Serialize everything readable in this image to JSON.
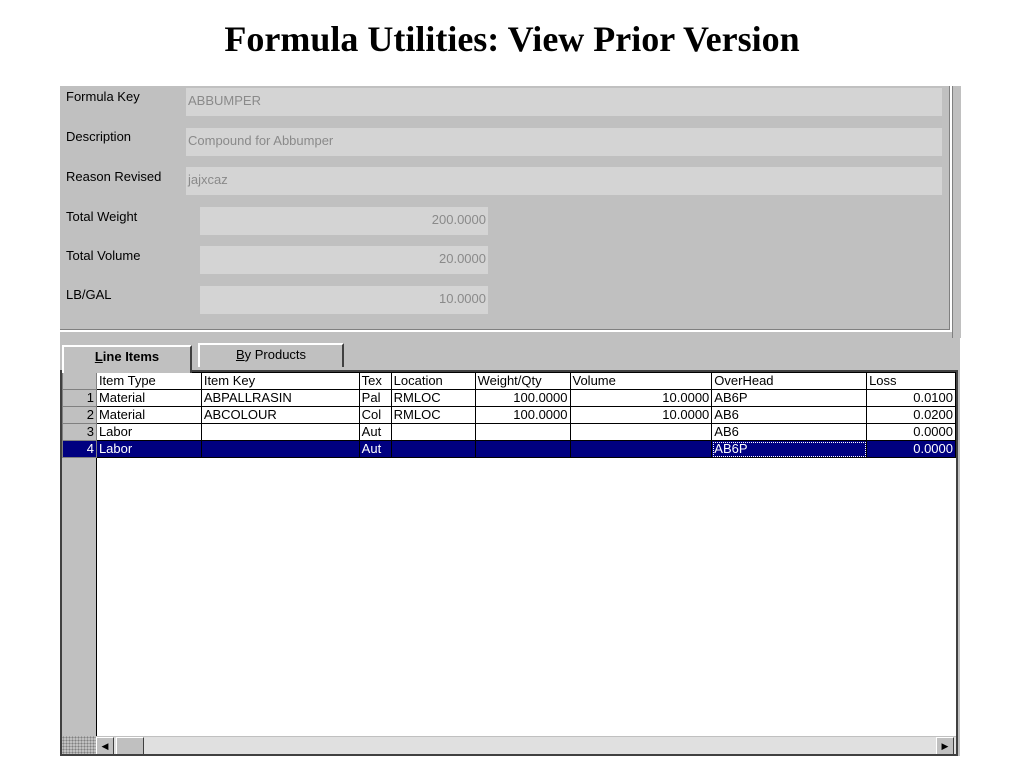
{
  "slide": {
    "title": "Formula Utilities: View Prior Version"
  },
  "form": {
    "formula_key_label": "Formula Key",
    "formula_key_value": "ABBUMPER",
    "description_label": "Description",
    "description_value": "Compound for Abbumper",
    "reason_label": "Reason Revised",
    "reason_value": "jajxcaz",
    "total_weight_label": "Total Weight",
    "total_weight_value": "200.0000",
    "total_volume_label": "Total Volume",
    "total_volume_value": "20.0000",
    "lbgal_label": "LB/GAL",
    "lbgal_value": "10.0000"
  },
  "tabs": {
    "line_items_first": "L",
    "line_items_rest": "ine Items",
    "by_products_first": "B",
    "by_products_rest": "y Products"
  },
  "grid": {
    "headers": [
      "Item Type",
      "Item Key",
      "Tex",
      "Location",
      "Weight/Qty",
      "Volume",
      "OverHead",
      "Loss"
    ],
    "rows": [
      {
        "n": "1",
        "type": "Material",
        "key": "ABPALLRASIN",
        "tex": "Pal",
        "loc": "RMLOC",
        "wq": "100.0000",
        "vol": "10.0000",
        "oh": "AB6P",
        "loss": "0.0100"
      },
      {
        "n": "2",
        "type": "Material",
        "key": "ABCOLOUR",
        "tex": "Col",
        "loc": "RMLOC",
        "wq": "100.0000",
        "vol": "10.0000",
        "oh": "AB6",
        "loss": "0.0200"
      },
      {
        "n": "3",
        "type": "Labor",
        "key": "",
        "tex": "Aut",
        "loc": "",
        "wq": "",
        "vol": "",
        "oh": "AB6",
        "loss": "0.0000"
      },
      {
        "n": "4",
        "type": "Labor",
        "key": "",
        "tex": "Aut",
        "loc": "",
        "wq": "",
        "vol": "",
        "oh": "AB6P",
        "loss": "0.0000"
      }
    ],
    "selected_row": 4
  },
  "scrollbar": {
    "left_arrow": "◀",
    "right_arrow": "▶"
  }
}
